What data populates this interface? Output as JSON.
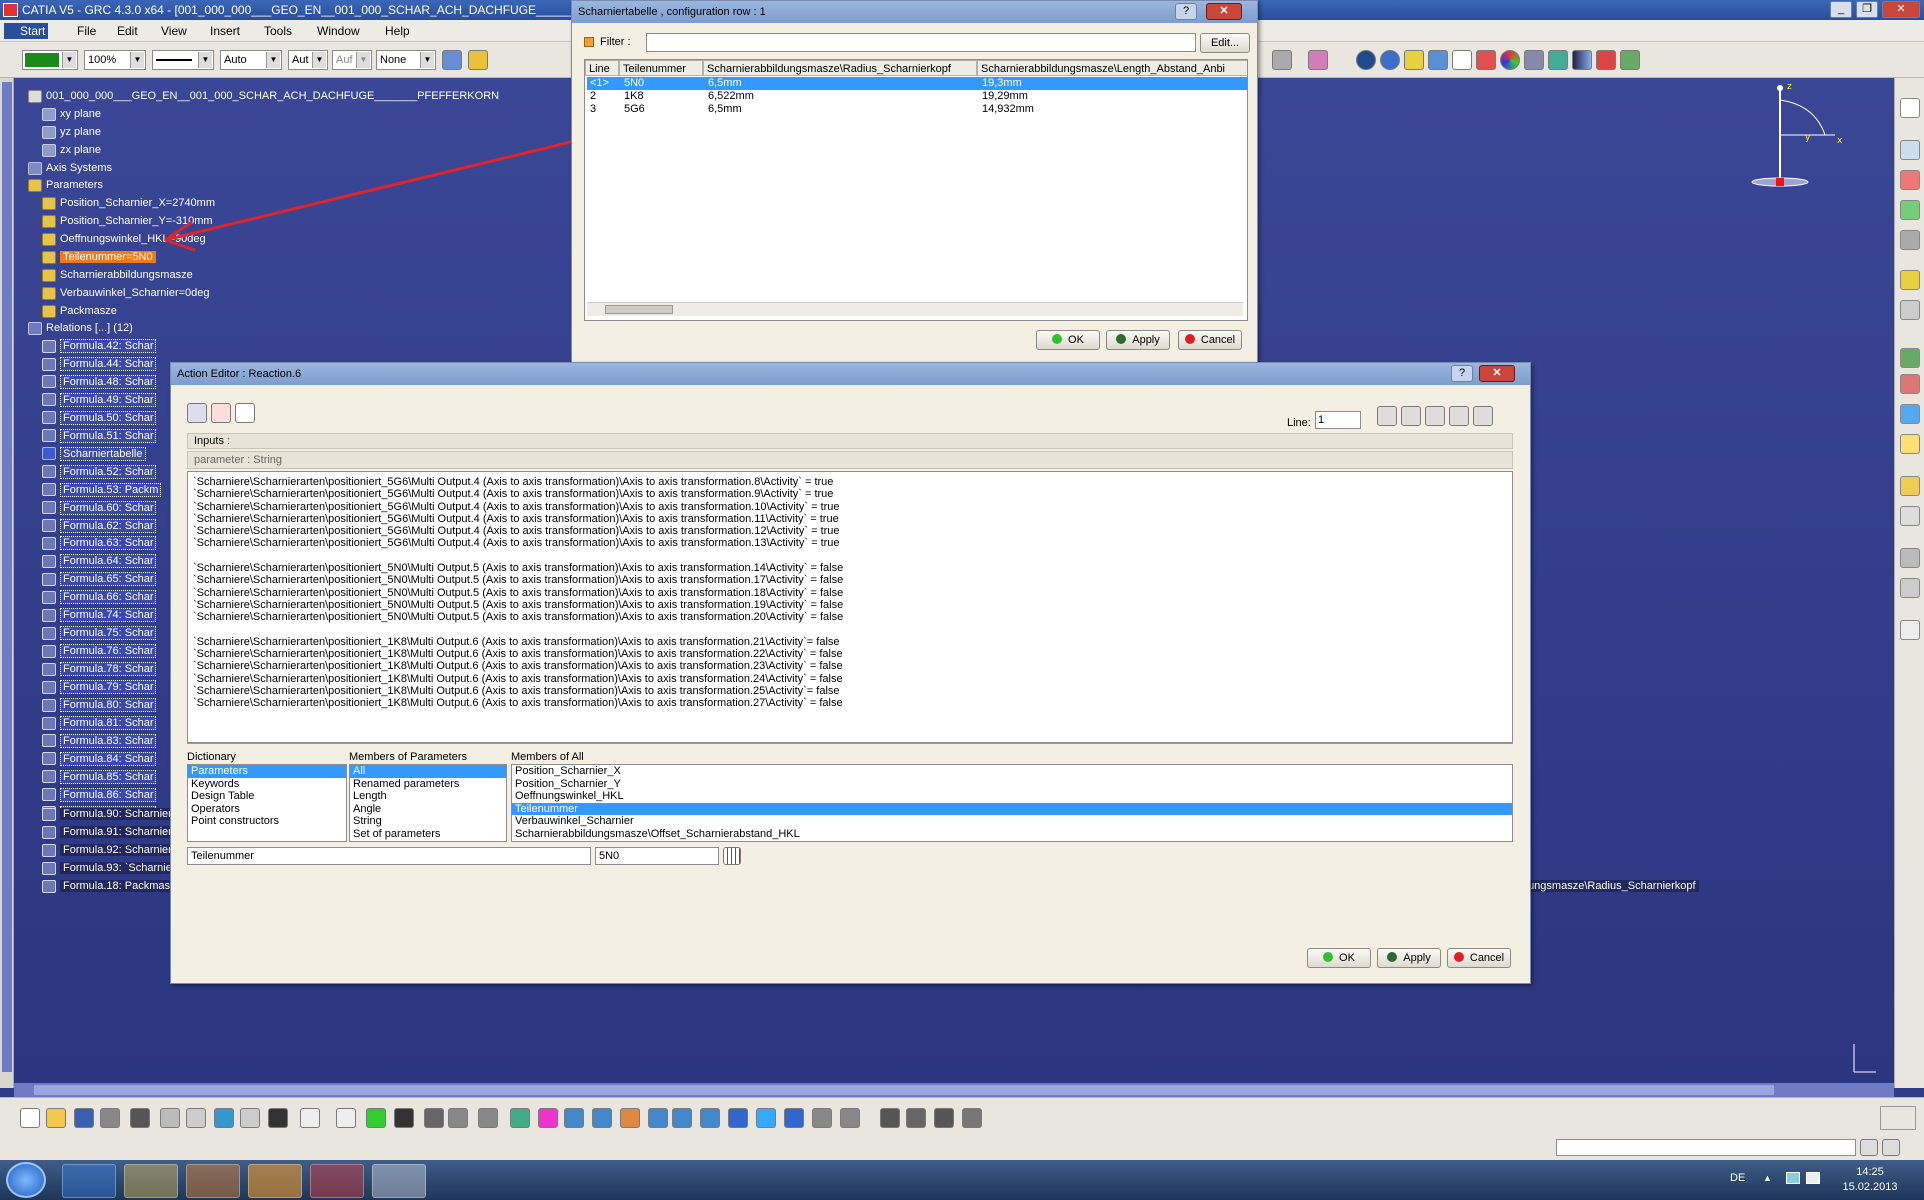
{
  "app": {
    "title": "CATIA V5 - GRC 4.3.0 x64 - [001_000_000___GEO_EN__001_000_SCHAR_ACH_DACHFUGE________PF"
  },
  "menu": [
    "Start",
    "File",
    "Edit",
    "View",
    "Insert",
    "Tools",
    "Window",
    "Help"
  ],
  "toolbar": {
    "color_value": "",
    "transparency": "100%",
    "line_type": "",
    "thickness": "Auto",
    "linetype2": "Aut",
    "layer": "Auf",
    "layer2": "None"
  },
  "tree": {
    "root": "001_000_000___GEO_EN__001_000_SCHAR_ACH_DACHFUGE_______PFEFFERKORN",
    "planes": [
      "xy plane",
      "yz plane",
      "zx plane"
    ],
    "axis_systems": "Axis Systems",
    "parameters_label": "Parameters",
    "params": [
      "Position_Scharnier_X=2740mm",
      "Position_Scharnier_Y=-310mm",
      "Oeffnungswinkel_HKL=90deg",
      "Teilenummer=5N0",
      "Scharnierabbildungsmasze",
      "Verbauwinkel_Scharnier=0deg",
      "Packmasze"
    ],
    "relations": "Relations [...] (12)",
    "formulas_short": [
      "Formula.42: Schar",
      "Formula.44: Schar",
      "Formula.48: Schar",
      "Formula.49: Schar",
      "Formula.50: Schar",
      "Formula.51: Schar",
      "Scharniertabelle",
      "Formula.52: Schar",
      "Formula.53: Packm",
      "Formula.60: Schar",
      "Formula.62: Schar",
      "Formula.63: Schar",
      "Formula.64: Schar",
      "Formula.65: Schar",
      "Formula.66: Schar",
      "Formula.74: Schar",
      "Formula.75: Schar",
      "Formula.76: Schar",
      "Formula.78: Schar",
      "Formula.79: Schar",
      "Formula.80: Schar",
      "Formula.81: Schar",
      "Formula.83: Schar",
      "Formula.84: Schar",
      "Formula.85: Schar",
      "Formula.86: Schar",
      "Formula.87: `Scha"
    ],
    "formulas_long": [
      "Formula.90: Scharniere\\Geometrie_Scharnier\\Sketch.5\\Offset.58\\Offset=Scharnierabbildungsmasze\\Offset_Scharnierfussabstand",
      "Formula.91: Scharniere\\Geometrie_Scharnier\\Sketch.5\\Offset.68\\Offset=Scharniere\\Geometrie_Scharnier\\Sketch.5\\Offset.30\\Offset -Scharnierabbildungsmasze\\Startpunkt_rel_Schraege_Z",
      "Formula.92: Scharniere\\Geometrie_Scharnier\\Sketch.5\\Angle.70\\Angle=Scharnierabbildungsmasze\\Angle_rel_Schraege",
      "Formula.93: `Scharniere\\Scharnierarten\\5N0_827_301\\Rotate.2\\Angle`=-(90deg+Scharnierabbildungsmasze\\Angle_Anbindung_HKL)",
      "Formula.18: Packmasze\\Packmasz_Dachhaut_Scharnierachse=Packmasze\\Laminatstaerke\\Staerke_Aussenteil_HKL + Packmasze\\Laminatstaerke\\Staerke_Innenteil_HKL + Packmasze\\Verhaltmasze\\Freigang_KTL+Packmasze\\Verhaltmasze\\Verhaltmasz_Flanschverklebungsdicke + Scharnierabbildungsmasze\\Radius_Scharnierkopf"
    ]
  },
  "table_dialog": {
    "title": "Scharniertabelle , configuration row : 1",
    "filter_label": "Filter :",
    "filter_value": "",
    "edit_button": "Edit...",
    "columns": [
      "Line",
      "Teilenummer",
      "Scharnierabbildungsmasze\\Radius_Scharnierkopf",
      "Scharnierabbildungsmasze\\Length_Abstand_Anbi"
    ],
    "rows": [
      [
        "<1>",
        "5N0",
        "6,5mm",
        "19,3mm"
      ],
      [
        "2",
        "1K8",
        "6,522mm",
        "19,29mm"
      ],
      [
        "3",
        "5G6",
        "6,5mm",
        "14,932mm"
      ]
    ],
    "ok": "OK",
    "apply": "Apply",
    "cancel": "Cancel"
  },
  "action_editor": {
    "title": "Action Editor : Reaction.6",
    "line_label": "Line:",
    "line_value": "1",
    "inputs_label": "Inputs :",
    "inputs_hint": "parameter : String",
    "code_lines": [
      "`Scharniere\\Scharnierarten\\positioniert_5G6\\Multi Output.4 (Axis to axis transformation)\\Axis to axis transformation.8\\Activity` = true",
      "`Scharniere\\Scharnierarten\\positioniert_5G6\\Multi Output.4 (Axis to axis transformation)\\Axis to axis transformation.9\\Activity` = true",
      "`Scharniere\\Scharnierarten\\positioniert_5G6\\Multi Output.4 (Axis to axis transformation)\\Axis to axis transformation.10\\Activity` = true",
      "`Scharniere\\Scharnierarten\\positioniert_5G6\\Multi Output.4 (Axis to axis transformation)\\Axis to axis transformation.11\\Activity` = true",
      "`Scharniere\\Scharnierarten\\positioniert_5G6\\Multi Output.4 (Axis to axis transformation)\\Axis to axis transformation.12\\Activity` = true",
      "`Scharniere\\Scharnierarten\\positioniert_5G6\\Multi Output.4 (Axis to axis transformation)\\Axis to axis transformation.13\\Activity` = true",
      "",
      "`Scharniere\\Scharnierarten\\positioniert_5N0\\Multi Output.5 (Axis to axis transformation)\\Axis to axis transformation.14\\Activity` = false",
      "`Scharniere\\Scharnierarten\\positioniert_5N0\\Multi Output.5 (Axis to axis transformation)\\Axis to axis transformation.17\\Activity` = false",
      "`Scharniere\\Scharnierarten\\positioniert_5N0\\Multi Output.5 (Axis to axis transformation)\\Axis to axis transformation.18\\Activity` = false",
      "`Scharniere\\Scharnierarten\\positioniert_5N0\\Multi Output.5 (Axis to axis transformation)\\Axis to axis transformation.19\\Activity` = false",
      "`Scharniere\\Scharnierarten\\positioniert_5N0\\Multi Output.5 (Axis to axis transformation)\\Axis to axis transformation.20\\Activity` = false",
      "",
      "`Scharniere\\Scharnierarten\\positioniert_1K8\\Multi Output.6 (Axis to axis transformation)\\Axis to axis transformation.21\\Activity`= false",
      "`Scharniere\\Scharnierarten\\positioniert_1K8\\Multi Output.6 (Axis to axis transformation)\\Axis to axis transformation.22\\Activity` = false",
      "`Scharniere\\Scharnierarten\\positioniert_1K8\\Multi Output.6 (Axis to axis transformation)\\Axis to axis transformation.23\\Activity` = false",
      "`Scharniere\\Scharnierarten\\positioniert_1K8\\Multi Output.6 (Axis to axis transformation)\\Axis to axis transformation.24\\Activity` = false",
      "`Scharniere\\Scharnierarten\\positioniert_1K8\\Multi Output.6 (Axis to axis transformation)\\Axis to axis transformation.25\\Activity`= false",
      "`Scharniere\\Scharnierarten\\positioniert_1K8\\Multi Output.6 (Axis to axis transformation)\\Axis to axis transformation.27\\Activity` = false"
    ],
    "dictionary_label": "Dictionary",
    "dictionary": [
      "Parameters",
      "Keywords",
      "Design Table",
      "Operators",
      "Point constructors"
    ],
    "members_params_label": "Members of Parameters",
    "members_params": [
      "All",
      "Renamed parameters",
      "Length",
      "Angle",
      "String",
      "Set of parameters"
    ],
    "members_all_label": "Members of All",
    "members_all": [
      "Position_Scharnier_X",
      "Position_Scharnier_Y",
      "Oeffnungswinkel_HKL",
      "Teilenummer",
      "Verbauwinkel_Scharnier",
      "Scharnierabbildungsmasze\\Offset_Scharnierabstand_HKL"
    ],
    "bottom_name": "Teilenummer",
    "bottom_value": "5N0",
    "ok": "OK",
    "apply": "Apply",
    "cancel": "Cancel"
  },
  "compass": {
    "z": "z",
    "y": "y",
    "x": "x"
  },
  "status": {
    "lang": "DE",
    "time": "14:25",
    "date": "15.02.2013"
  },
  "colors": {
    "viewport": "#3a4796",
    "selection_orange": "#f07a1a",
    "list_selection": "#3399ff",
    "arrow": "#e0242a"
  }
}
